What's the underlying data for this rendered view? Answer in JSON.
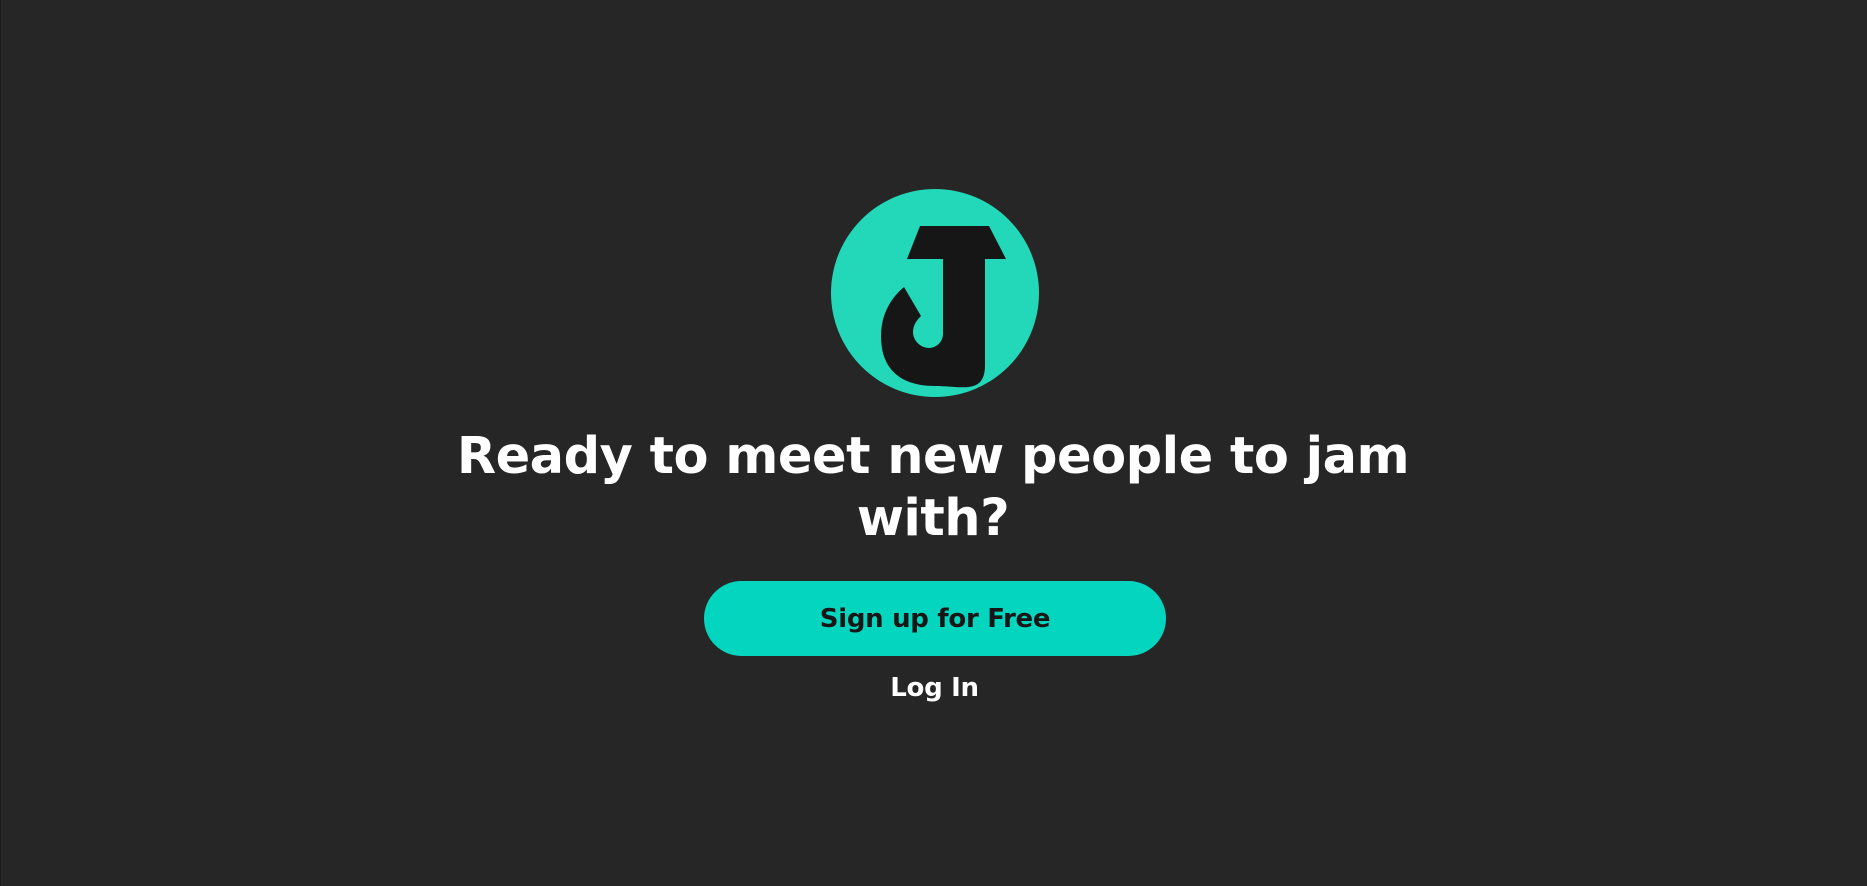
{
  "theme": {
    "background": "#262626",
    "accent": "#04d5bf",
    "logo_circle": "#22d8b8",
    "logo_mark": "#161616",
    "text": "#ffffff"
  },
  "logo": {
    "icon": "j-letter-logo-icon"
  },
  "hero": {
    "headline": "Ready to meet new people to jam with?",
    "signup_label": "Sign up for Free",
    "login_label": "Log In"
  }
}
